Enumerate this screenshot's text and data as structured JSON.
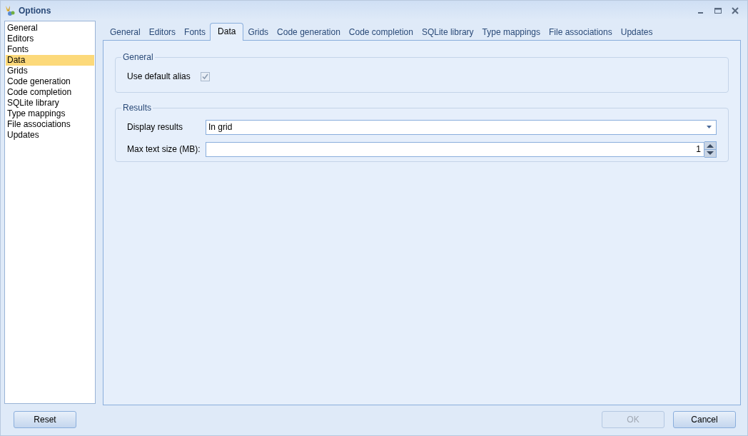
{
  "window": {
    "title": "Options"
  },
  "sidebar": {
    "items": [
      {
        "label": "General",
        "selected": false
      },
      {
        "label": "Editors",
        "selected": false
      },
      {
        "label": "Fonts",
        "selected": false
      },
      {
        "label": "Data",
        "selected": true
      },
      {
        "label": "Grids",
        "selected": false
      },
      {
        "label": "Code generation",
        "selected": false
      },
      {
        "label": "Code completion",
        "selected": false
      },
      {
        "label": "SQLite library",
        "selected": false
      },
      {
        "label": "Type mappings",
        "selected": false
      },
      {
        "label": "File associations",
        "selected": false
      },
      {
        "label": "Updates",
        "selected": false
      }
    ]
  },
  "tabs": [
    {
      "label": "General",
      "selected": false
    },
    {
      "label": "Editors",
      "selected": false
    },
    {
      "label": "Fonts",
      "selected": false
    },
    {
      "label": "Data",
      "selected": true
    },
    {
      "label": "Grids",
      "selected": false
    },
    {
      "label": "Code generation",
      "selected": false
    },
    {
      "label": "Code completion",
      "selected": false
    },
    {
      "label": "SQLite library",
      "selected": false
    },
    {
      "label": "Type mappings",
      "selected": false
    },
    {
      "label": "File associations",
      "selected": false
    },
    {
      "label": "Updates",
      "selected": false
    }
  ],
  "general_group": {
    "title": "General",
    "use_default_alias": {
      "label": "Use default alias",
      "checked": true
    }
  },
  "results_group": {
    "title": "Results",
    "display_results": {
      "label": "Display results",
      "value": "In grid"
    },
    "max_text_size": {
      "label": "Max text size (MB):",
      "value": "1"
    }
  },
  "buttons": [
    {
      "label": "Reset",
      "disabled": false
    },
    {
      "label": "OK",
      "disabled": true
    },
    {
      "label": "Cancel",
      "disabled": false
    }
  ]
}
